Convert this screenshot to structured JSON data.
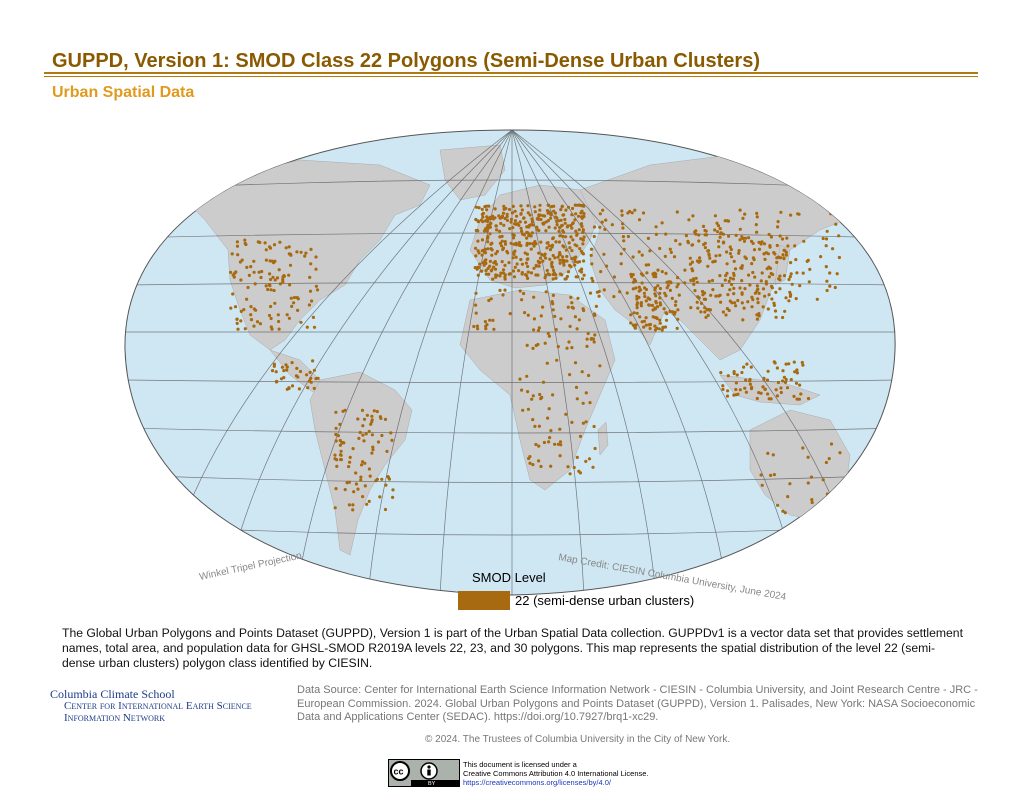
{
  "header": {
    "title": "GUPPD, Version 1: SMOD Class 22 Polygons (Semi-Dense Urban Clusters)",
    "subtitle": "Urban Spatial Data"
  },
  "map": {
    "projection_label": "Winkel Tripel Projection",
    "credit": "Map Credit: CIESIN Columbia University, June 2024",
    "colors": {
      "ocean": "#cfe7f3",
      "land": "#cccccc",
      "dots": "#a86a10",
      "graticule": "#4a4a4a"
    }
  },
  "legend": {
    "title": "SMOD Level",
    "items": [
      {
        "label": "22 (semi-dense urban clusters)",
        "color": "#a86a10"
      }
    ]
  },
  "description": "The Global Urban Polygons and Points Dataset (GUPPD), Version 1 is part of the Urban Spatial Data collection. GUPPDv1 is a vector data set that provides settlement names, total area, and population data for GHSL-SMOD R2019A levels 22, 23, and 30 polygons. This map represents the spatial distribution of the level 22 (semi-dense urban clusters) polygon class identified by CIESIN.",
  "footer": {
    "org": {
      "line1": "Columbia Climate School",
      "line2": "Center for International Earth Science",
      "line3": "Information Network"
    },
    "data_source": "Data Source: Center for International Earth Science Information Network - CIESIN - Columbia University, and Joint Research Centre - JRC - European Commission. 2024. Global Urban Polygons and Points Dataset (GUPPD), Version 1. Palisades, New York: NASA Socioeconomic Data and Applications Center (SEDAC). https://doi.org/10.7927/brq1-xc29.",
    "copyright": "© 2024. The Trustees of Columbia University in the City of New York.",
    "license": {
      "line1": "This document is licensed under a",
      "line2": "Creative Commons Attribution 4.0 International License.",
      "link": "https://creativecommons.org/licenses/by/4.0/",
      "badge": "BY"
    }
  }
}
